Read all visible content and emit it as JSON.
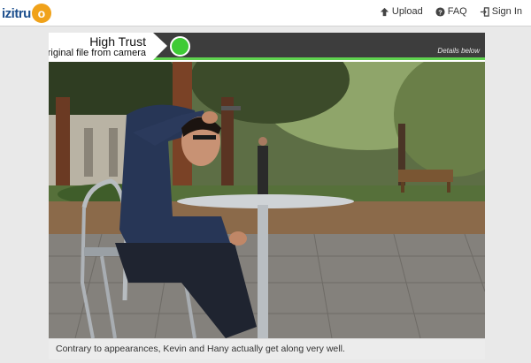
{
  "header": {
    "logo_text": "izitru",
    "logo_mark": "o",
    "nav": [
      {
        "label": "Upload",
        "icon": "upload-icon"
      },
      {
        "label": "FAQ",
        "icon": "help-icon"
      },
      {
        "label": "Sign In",
        "icon": "sign-in-icon"
      }
    ]
  },
  "result": {
    "trust_title": "High Trust",
    "trust_subtitle": "Original file from camera",
    "status_color": "#3ecb35",
    "details_link": "Details below"
  },
  "photo": {
    "caption": "Contrary to appearances, Kevin and Hany actually get along very well."
  }
}
